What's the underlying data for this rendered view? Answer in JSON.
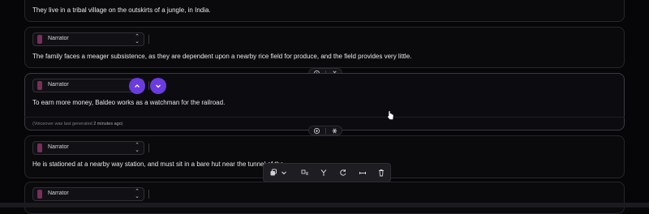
{
  "blocks": [
    {
      "text": "They live in a tribal village on the outskirts of a jungle, in India."
    },
    {
      "speaker": "Narrator",
      "text": "The family faces a meager subsistence, as they are dependent upon a nearby rice field for produce, and the field provides very little."
    },
    {
      "speaker": "Narrator",
      "text": "To earn more money, Baldeo works as a watchman for the railroad.",
      "meta_prefix": "(Voiceover was last generated",
      "meta_time": "2 minutes ago",
      "meta_suffix": ")"
    },
    {
      "speaker": "Narrator",
      "text": "He is stationed at a nearby way station, and must sit in a bare hut near the tunnel of the"
    },
    {
      "speaker": "Narrator"
    }
  ],
  "active_block_controls": {
    "move_up_icon": "chevron-up-icon",
    "move_down_icon": "chevron-down-icon",
    "accent": "#6b3be0"
  },
  "insert_controls": {
    "add_icon": "add-circle-icon",
    "split_icon": "split-icon"
  },
  "toolbar": {
    "items": [
      "copy-icon",
      "chevron-down-icon",
      "swap-icon",
      "branch-icon",
      "regenerate-icon",
      "pause-icon",
      "delete-icon"
    ]
  }
}
